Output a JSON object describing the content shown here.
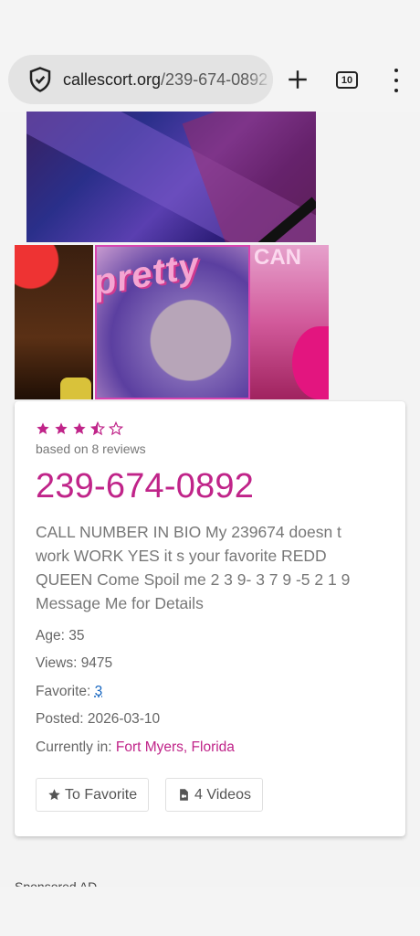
{
  "browser": {
    "url_host": "callescort.org",
    "url_path": "/239-674-0892",
    "tab_count": "10",
    "icons": [
      "shield-icon",
      "plus-icon",
      "tabs-icon",
      "menu-icon"
    ]
  },
  "listing": {
    "rating": 3.5,
    "rating_max": 5,
    "reviews_text": "based on 8 reviews",
    "phone": "239-674-0892",
    "description": "CALL NUMBER IN BIO My 239674 doesn t work WORK YES it s your favorite REDD QUEEN Come Spoil me 2 3 9- 3 7 9 -5 2 1 9 Message Me for Details",
    "age_label": "Age:",
    "age_value": "35",
    "views_label": "Views:",
    "views_value": "9475",
    "favorite_label": "Favorite:",
    "favorite_value": "3",
    "posted_label": "Posted:",
    "posted_value": "2026-03-10",
    "location_label": "Currently in:",
    "location_value": "Fort Myers, Florida",
    "to_favorite_label": "To Favorite",
    "videos_label": "4 Videos"
  },
  "colors": {
    "accent": "#c02489",
    "link": "#1565c0"
  },
  "footer": {
    "sponsored_label": "Sponsored AD"
  }
}
